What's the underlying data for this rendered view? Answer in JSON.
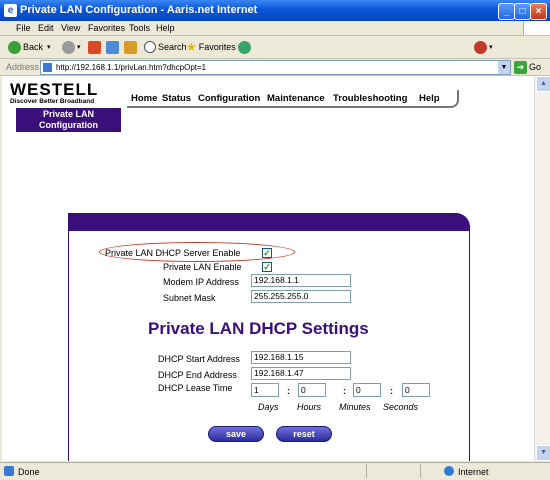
{
  "window": {
    "title": "Private LAN Configuration - Aaris.net Internet"
  },
  "menu": {
    "items": [
      "File",
      "Edit",
      "View",
      "Favorites",
      "Tools",
      "Help"
    ]
  },
  "toolbar": {
    "back": "Back",
    "search": "Search",
    "favorites": "Favorites"
  },
  "address": {
    "label": "Address",
    "url": "http://192.168.1.1/privLan.htm?dhcpOpt=1",
    "go": "Go"
  },
  "brand": {
    "name": "WESTELL",
    "tagline": "Discover Better Broadband"
  },
  "nav": {
    "items": [
      "Home",
      "Status",
      "Configuration",
      "Maintenance",
      "Troubleshooting",
      "Help"
    ]
  },
  "sidebar": {
    "active_line1": "Private LAN",
    "active_line2": "Configuration"
  },
  "form": {
    "dhcp_server_enable_label": "Private LAN DHCP Server Enable",
    "dhcp_server_enable_checked": true,
    "lan_enable_label": "Private LAN Enable",
    "lan_enable_checked": true,
    "modem_ip_label": "Modem IP Address",
    "modem_ip_value": "192.168.1.1",
    "subnet_label": "Subnet Mask",
    "subnet_value": "255.255.255.0",
    "section_title": "Private LAN DHCP Settings",
    "dhcp_start_label": "DHCP Start Address",
    "dhcp_start_value": "192.168.1.15",
    "dhcp_end_label": "DHCP End Address",
    "dhcp_end_value": "192.168.1.47",
    "lease_label": "DHCP Lease Time",
    "lease_days": "1",
    "lease_hours": "0",
    "lease_minutes": "0",
    "lease_seconds": "0",
    "unit_days": "Days",
    "unit_hours": "Hours",
    "unit_minutes": "Minutes",
    "unit_seconds": "Seconds",
    "colon": ":",
    "save_label": "save",
    "reset_label": "reset"
  },
  "status": {
    "left": "Done",
    "zone": "Internet"
  }
}
